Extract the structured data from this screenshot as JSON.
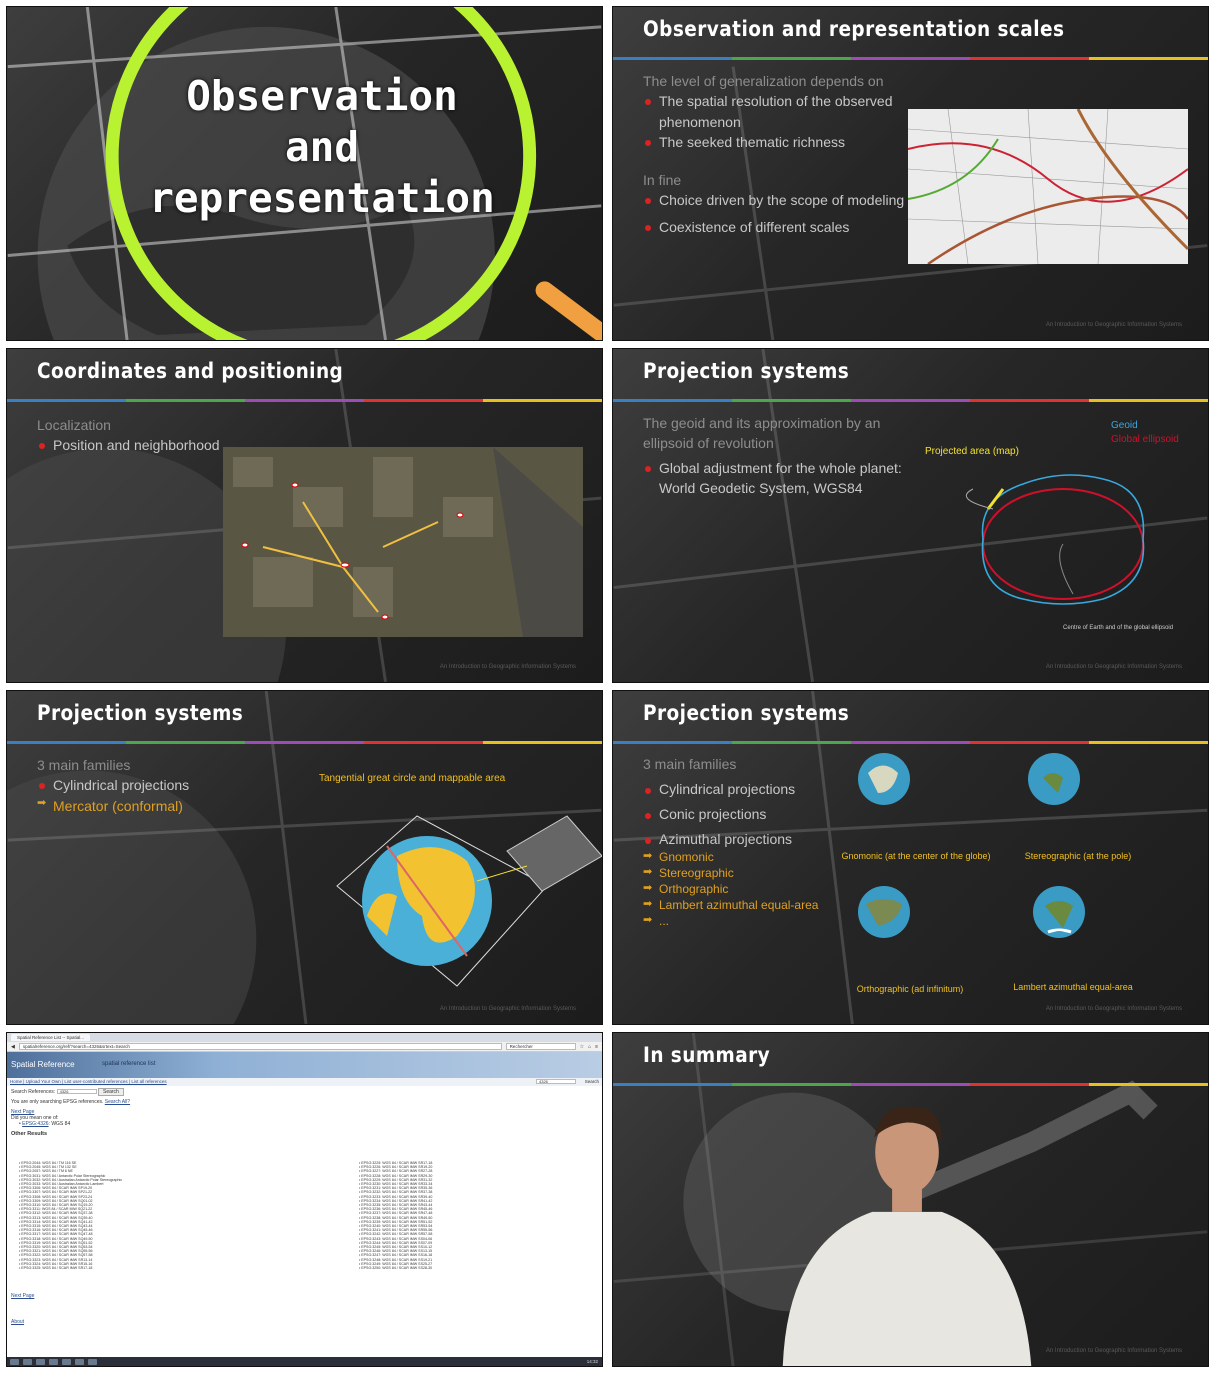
{
  "stripe_colors": [
    "#3a7fbf",
    "#4da64d",
    "#9b4db3",
    "#d33",
    "#e6c020"
  ],
  "slide1": {
    "title_lines": [
      "Observation",
      "and",
      "representation"
    ]
  },
  "slide2": {
    "title": "Observation and representation scales",
    "intro": "The level of generalization depends on",
    "bullets_a": [
      "The spatial resolution of the observed phenomenon",
      "The seeked thematic richness"
    ],
    "subhead": "In fine",
    "bullets_b": [
      "Choice driven by the scope of modeling",
      "Coexistence of different scales"
    ],
    "footer": "An Introduction to Geographic Information Systems"
  },
  "slide3": {
    "title": "Coordinates and positioning",
    "subhead": "Localization",
    "bullets": [
      "Position and neighborhood"
    ],
    "footer": "An Introduction to Geographic Information Systems"
  },
  "slide4": {
    "title": "Projection systems",
    "intro": "The geoid and its approximation by an ellipsoid of revolution",
    "bullets": [
      "Global adjustment for the whole planet: World Geodetic System, WGS84"
    ],
    "label_projected": "Projected area (map)",
    "label_geoid": "Geoid",
    "label_ellipsoid": "Global ellipsoid",
    "label_centre": "Centre of Earth and of the global ellipsoid",
    "footer": "An Introduction to Geographic Information Systems"
  },
  "slide5": {
    "title": "Projection systems",
    "subhead": "3 main families",
    "bullets": [
      "Cylindrical projections"
    ],
    "sub_items": [
      "Mercator (conformal)"
    ],
    "caption": "Tangential great circle and mappable area",
    "footer": "An Introduction to Geographic Information Systems"
  },
  "slide6": {
    "title": "Projection systems",
    "subhead": "3 main families",
    "bullets": [
      "Cylindrical projections",
      "Conic projections",
      "Azimuthal projections"
    ],
    "sub_items": [
      "Gnomonic",
      "Stereographic",
      "Orthographic",
      "Lambert azimuthal equal-area",
      "..."
    ],
    "globe_captions": [
      "Gnomonic (at the center of the globe)",
      "Stereographic (at the pole)",
      "Orthographic (ad infinitum)",
      "Lambert azimuthal equal-area"
    ],
    "footer": "An Introduction to Geographic Information Systems"
  },
  "browser": {
    "tab_label": "Spatial Reference List -- Spatial...",
    "url": "spatialreference.org/ref/?search=4326&srtext=Search",
    "search_placeholder": "Rechercher",
    "site_name": "Spatial Reference",
    "page_heading": "spatial reference list",
    "nav_links": "Home | Upload Your Own | List user-contributed references | List all references",
    "top_search_value": "4326",
    "top_search_button": "Search",
    "search_label": "Search References:",
    "search_value": "4326",
    "search_button": "Search",
    "epsg_note": "You are only searching EPSG references.",
    "search_all": "Search All?",
    "next_page": "Next Page",
    "did_you_mean": "Did you mean one of:",
    "suggestion_link": "EPSG:4326",
    "suggestion_text": ": WGS 84",
    "other_results": "Other Results",
    "results_left": [
      "EPSG:2044: WGS 84 / TM 116 SE",
      "EPSG:2045: WGS 84 / TM 132 SE",
      "EPSG:2057: WGS 84 / TM 6 NE",
      "EPSG:3031: WGS 84 / Antarctic Polar Stereographic",
      "EPSG:3032: WGS 84 / Australian Antarctic Polar Stereographic",
      "EPSG:3033: WGS 84 / Australian Antarctic Lambert",
      "EPSG:3306: WGS 84 / SCAR IMW SP19-20",
      "EPSG:3307: WGS 84 / SCAR IMW SP21-22",
      "EPSG:3308: WGS 84 / SCAR IMW SP23-24",
      "EPSG:3309: WGS 84 / SCAR IMW SQ01-02",
      "EPSG:3310: WGS 84 / SCAR IMW SQ19-20",
      "EPSG:3311: WGS 84 / SCAR IMW SQ21-22",
      "EPSG:3312: WGS 84 / SCAR IMW SQ37-38",
      "EPSG:3313: WGS 84 / SCAR IMW SQ39-40",
      "EPSG:3314: WGS 84 / SCAR IMW SQ41-42",
      "EPSG:3315: WGS 84 / SCAR IMW SQ43-44",
      "EPSG:3316: WGS 84 / SCAR IMW SQ45-46",
      "EPSG:3317: WGS 84 / SCAR IMW SQ47-48",
      "EPSG:3318: WGS 84 / SCAR IMW SQ49-50",
      "EPSG:3319: WGS 84 / SCAR IMW SQ51-52",
      "EPSG:3320: WGS 84 / SCAR IMW SQ53-54",
      "EPSG:3321: WGS 84 / SCAR IMW SQ55-56",
      "EPSG:3322: WGS 84 / SCAR IMW SQ57-58",
      "EPSG:3323: WGS 84 / SCAR IMW SR13-14",
      "EPSG:3324: WGS 84 / SCAR IMW SR15-16",
      "EPSG:3325: WGS 84 / SCAR IMW SR17-18"
    ],
    "results_right": [
      "EPSG:3225: WGS 84 / SCAR IMW SR17-18",
      "EPSG:3226: WGS 84 / SCAR IMW SR19-20",
      "EPSG:3227: WGS 84 / SCAR IMW SR27-28",
      "EPSG:3228: WGS 84 / SCAR IMW SR29-30",
      "EPSG:3229: WGS 84 / SCAR IMW SR31-32",
      "EPSG:3230: WGS 84 / SCAR IMW SR33-34",
      "EPSG:3231: WGS 84 / SCAR IMW SR35-36",
      "EPSG:3232: WGS 84 / SCAR IMW SR37-38",
      "EPSG:3233: WGS 84 / SCAR IMW SR39-40",
      "EPSG:3234: WGS 84 / SCAR IMW SR41-42",
      "EPSG:3235: WGS 84 / SCAR IMW SR43-44",
      "EPSG:3236: WGS 84 / SCAR IMW SR45-46",
      "EPSG:3237: WGS 84 / SCAR IMW SR47-48",
      "EPSG:3238: WGS 84 / SCAR IMW SR49-50",
      "EPSG:3239: WGS 84 / SCAR IMW SR51-52",
      "EPSG:3240: WGS 84 / SCAR IMW SR53-54",
      "EPSG:3241: WGS 84 / SCAR IMW SR55-56",
      "EPSG:3242: WGS 84 / SCAR IMW SR57-58",
      "EPSG:3243: WGS 84 / SCAR IMW SS04-06",
      "EPSG:3244: WGS 84 / SCAR IMW SS07-09",
      "EPSG:3245: WGS 84 / SCAR IMW SS10-12",
      "EPSG:3246: WGS 84 / SCAR IMW SS13-15",
      "EPSG:3247: WGS 84 / SCAR IMW SS16-18",
      "EPSG:3248: WGS 84 / SCAR IMW SS19-21",
      "EPSG:3249: WGS 84 / SCAR IMW SS25-27",
      "EPSG:3250: WGS 84 / SCAR IMW SS28-30"
    ],
    "bottom_next": "Next Page",
    "about": "About",
    "clock": "14:32"
  },
  "slide8": {
    "title": "In summary",
    "footer": "An Introduction to Geographic Information Systems"
  }
}
